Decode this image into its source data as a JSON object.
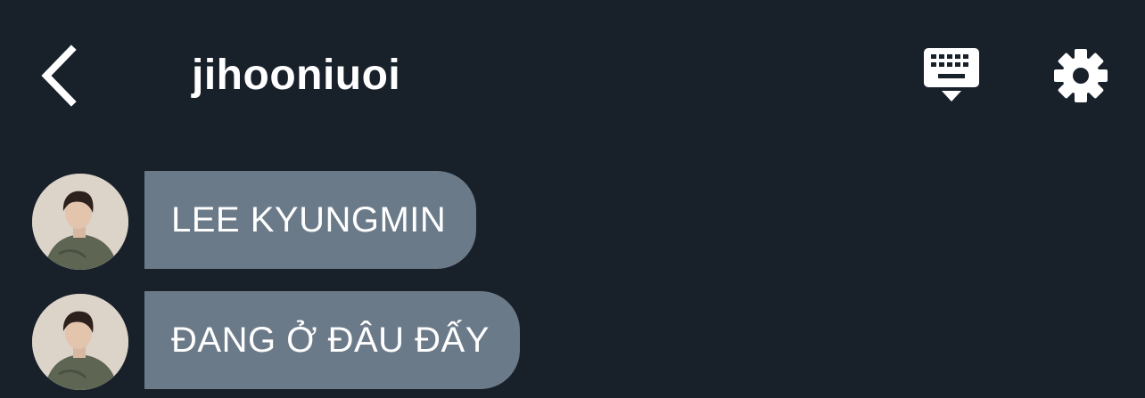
{
  "header": {
    "back_icon": "chevron-left-icon",
    "title": "jihooniuoi",
    "keyboard_icon": "keyboard-hide-icon",
    "settings_icon": "gear-icon"
  },
  "messages": [
    {
      "text": "LEE KYUNGMIN"
    },
    {
      "text": "ĐANG Ở ĐÂU ĐẤY"
    }
  ],
  "colors": {
    "background": "#18202a",
    "bubble": "#6b7a89",
    "text": "#ffffff"
  }
}
